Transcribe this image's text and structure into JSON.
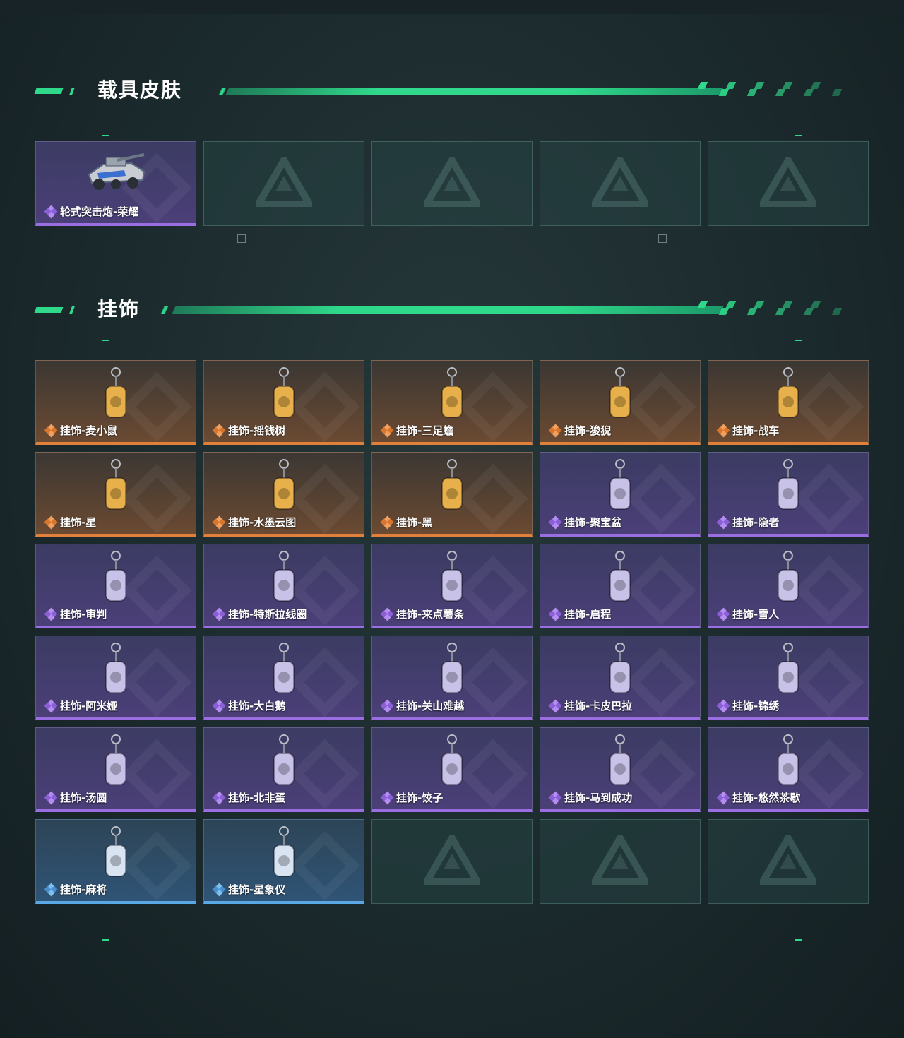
{
  "sections": [
    {
      "title": "载具皮肤",
      "items": [
        {
          "name": "轮式突击炮-荣耀",
          "rarity": "purple",
          "icon": "armored-vehicle-icon"
        },
        {
          "name": "",
          "rarity": "empty"
        },
        {
          "name": "",
          "rarity": "empty"
        },
        {
          "name": "",
          "rarity": "empty"
        },
        {
          "name": "",
          "rarity": "empty"
        }
      ]
    },
    {
      "title": "挂饰",
      "items": [
        {
          "name": "挂饰-麦小鼠",
          "rarity": "orange",
          "icon": "mouse-charm-icon"
        },
        {
          "name": "挂饰-摇钱树",
          "rarity": "orange",
          "icon": "money-tree-charm-icon"
        },
        {
          "name": "挂饰-三足蟾",
          "rarity": "orange",
          "icon": "toad-charm-icon"
        },
        {
          "name": "挂饰-狻猊",
          "rarity": "orange",
          "icon": "lion-charm-icon"
        },
        {
          "name": "挂饰-战车",
          "rarity": "orange",
          "icon": "tarot-card-charm-icon"
        },
        {
          "name": "挂饰-星",
          "rarity": "orange",
          "icon": "tarot-card-charm-icon"
        },
        {
          "name": "挂饰-水墨云图",
          "rarity": "orange",
          "icon": "ball-charm-icon"
        },
        {
          "name": "挂饰-黑",
          "rarity": "orange",
          "icon": "tag-charm-icon"
        },
        {
          "name": "挂饰-聚宝盆",
          "rarity": "purple",
          "icon": "bowl-charm-icon"
        },
        {
          "name": "挂饰-隐者",
          "rarity": "purple",
          "icon": "tarot-card-charm-icon"
        },
        {
          "name": "挂饰-审判",
          "rarity": "purple",
          "icon": "tarot-card-charm-icon"
        },
        {
          "name": "挂饰-特斯拉线圈",
          "rarity": "purple",
          "icon": "coil-charm-icon"
        },
        {
          "name": "挂饰-来点薯条",
          "rarity": "purple",
          "icon": "fries-charm-icon"
        },
        {
          "name": "挂饰-启程",
          "rarity": "purple",
          "icon": "badge-charm-icon"
        },
        {
          "name": "挂饰-雪人",
          "rarity": "purple",
          "icon": "snowman-charm-icon"
        },
        {
          "name": "挂饰-阿米娅",
          "rarity": "purple",
          "icon": "character-charm-icon"
        },
        {
          "name": "挂饰-大白鹅",
          "rarity": "purple",
          "icon": "goose-charm-icon"
        },
        {
          "name": "挂饰-关山难越",
          "rarity": "purple",
          "icon": "scroll-charm-icon"
        },
        {
          "name": "挂饰-卡皮巴拉",
          "rarity": "purple",
          "icon": "capybara-charm-icon"
        },
        {
          "name": "挂饰-锦绣",
          "rarity": "purple",
          "icon": "butterfly-charm-icon"
        },
        {
          "name": "挂饰-汤圆",
          "rarity": "purple",
          "icon": "bowl-charm-icon"
        },
        {
          "name": "挂饰-北非蛋",
          "rarity": "purple",
          "icon": "pan-charm-icon"
        },
        {
          "name": "挂饰-饺子",
          "rarity": "purple",
          "icon": "plate-charm-icon"
        },
        {
          "name": "挂饰-马到成功",
          "rarity": "purple",
          "icon": "horse-charm-icon"
        },
        {
          "name": "挂饰-悠然茶歇",
          "rarity": "purple",
          "icon": "cupcake-charm-icon"
        },
        {
          "name": "挂饰-麻将",
          "rarity": "blue",
          "icon": "mahjong-tile-charm-icon"
        },
        {
          "name": "挂饰-星象仪",
          "rarity": "blue",
          "icon": "astrolabe-charm-icon"
        },
        {
          "name": "",
          "rarity": "empty"
        },
        {
          "name": "",
          "rarity": "empty"
        },
        {
          "name": "",
          "rarity": "empty"
        }
      ]
    }
  ],
  "colors": {
    "accent": "#2fd88a",
    "purple": "#9a6de0",
    "orange": "#e0803a",
    "blue": "#5aa7e8"
  }
}
